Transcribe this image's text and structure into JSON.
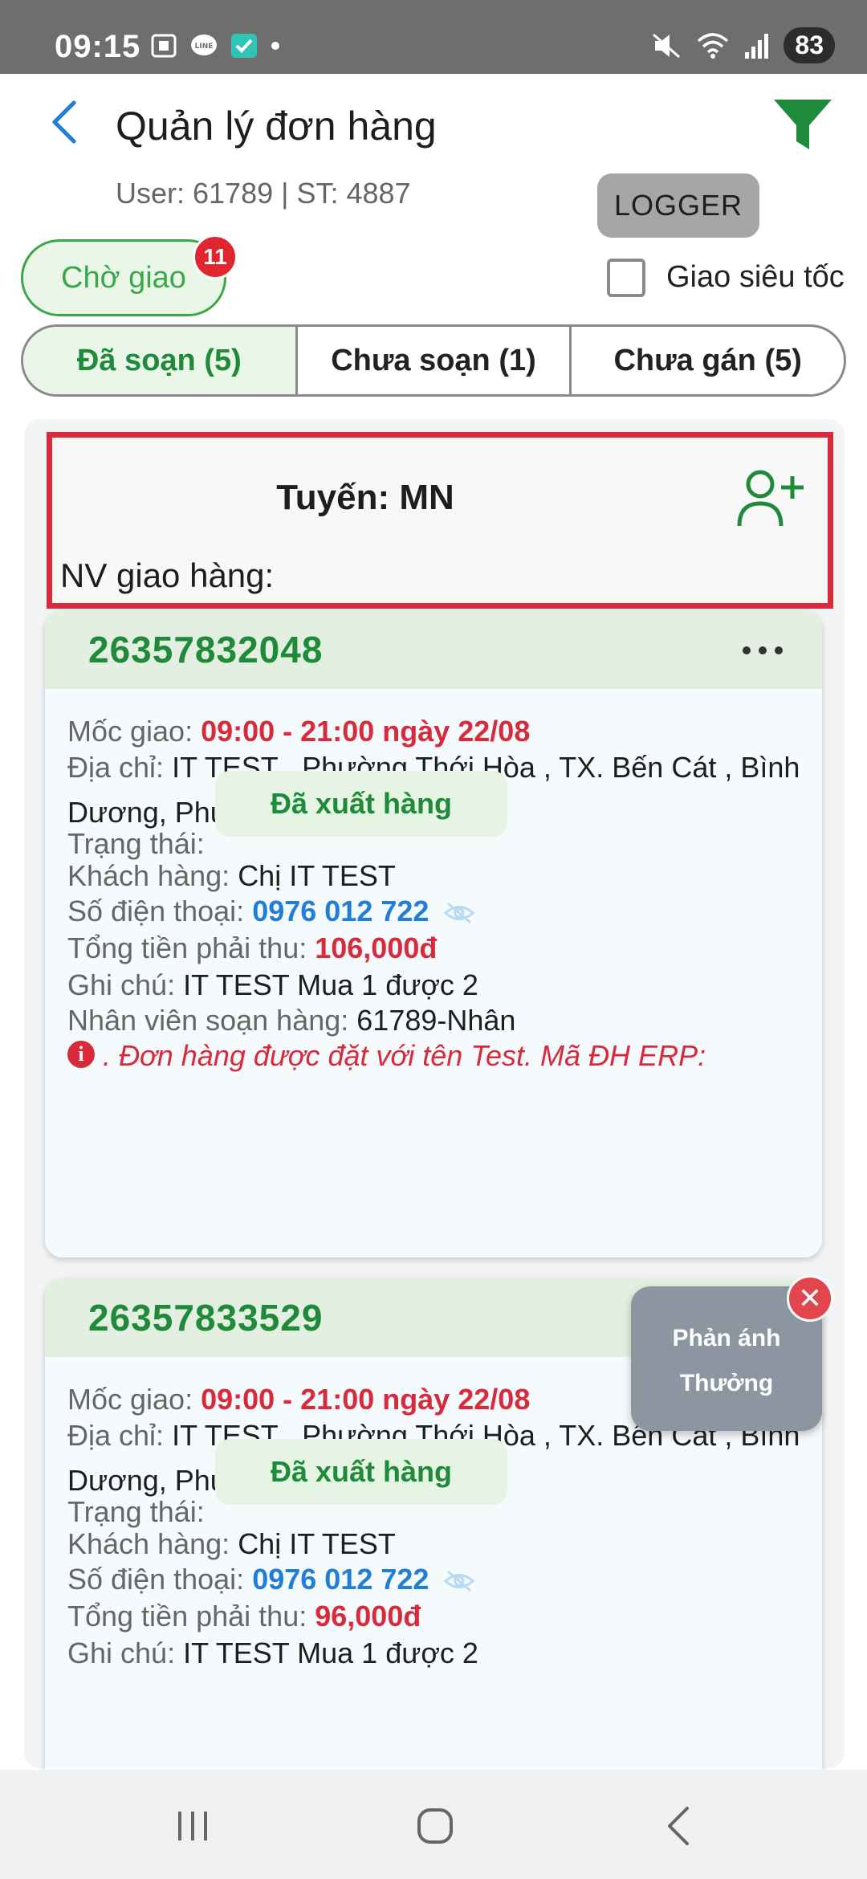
{
  "status_bar": {
    "time": "09:15",
    "battery": "83"
  },
  "header": {
    "title": "Quản lý đơn hàng",
    "user_info": "User: 61789 | ST: 4887",
    "logger_label": "LOGGER"
  },
  "chips": {
    "cho_giao_label": "Chờ giao",
    "cho_giao_count": "11",
    "giao_sieu_toc_label": "Giao siêu tốc"
  },
  "tabs": [
    {
      "label": "Đã soạn (5)",
      "active": true
    },
    {
      "label": "Chưa soạn (1)",
      "active": false
    },
    {
      "label": "Chưa gán (5)",
      "active": false
    }
  ],
  "route": {
    "title": "Tuyến: MN",
    "nv_label": "NV giao hàng:"
  },
  "labels": {
    "moc_giao": "Mốc giao:",
    "dia_chi": "Địa chỉ:",
    "trang_thai": "Trạng thái:",
    "khach_hang": "Khách hàng:",
    "so_dien_thoai": "Số điện thoại:",
    "tong_tien": "Tổng tiền phải thu:",
    "ghi_chu": "Ghi chú:",
    "nv_soan_hang": "Nhân viên soạn hàng:"
  },
  "orders": [
    {
      "id": "26357832048",
      "moc_giao": "09:00 - 21:00 ngày 22/08",
      "dia_chi": "IT TEST , Phường Thới Hòa , TX. Bến Cát , Bình Dương, Phường Thới Hòa, null",
      "trang_thai": "Đã xuất hàng",
      "khach_hang": "Chị IT TEST",
      "so_dien_thoai": "0976 012 722",
      "tong_tien": "106,000đ",
      "ghi_chu": "IT TEST Mua 1 được 2",
      "nv_soan_hang": "61789-Nhân",
      "note": ". Đơn hàng được đặt với tên Test. Mã ĐH ERP:"
    },
    {
      "id": "26357833529",
      "moc_giao": "09:00 - 21:00 ngày 22/08",
      "dia_chi": "IT TEST , Phường Thới Hòa , TX. Bến Cát , Bình Dương, Phường Thới Hòa, null",
      "trang_thai": "Đã xuất hàng",
      "khach_hang": "Chị IT TEST",
      "so_dien_thoai": "0976 012 722",
      "tong_tien": "96,000đ",
      "ghi_chu": "IT TEST Mua 1 được 2"
    }
  ],
  "float_widget": {
    "line1": "Phản ánh",
    "line2": "Thưởng"
  },
  "colors": {
    "green": "#1f8a3a",
    "red": "#d92a3b",
    "blue": "#1e7ed8"
  }
}
